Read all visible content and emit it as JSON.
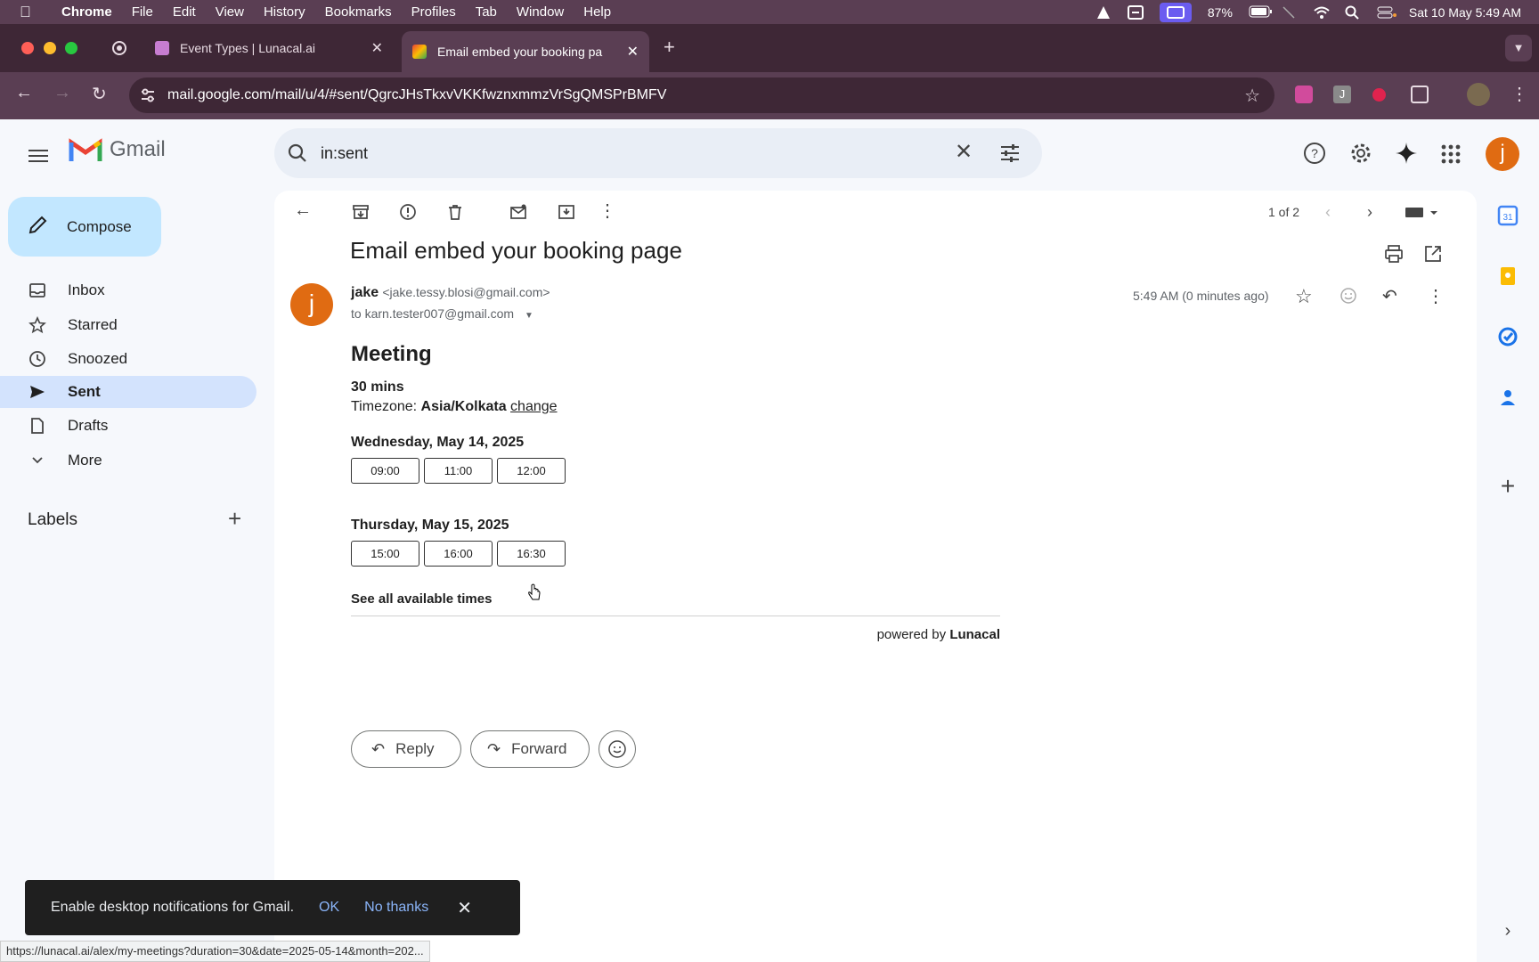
{
  "menubar": {
    "app": "Chrome",
    "items": [
      "File",
      "Edit",
      "View",
      "History",
      "Bookmarks",
      "Profiles",
      "Tab",
      "Window",
      "Help"
    ],
    "battery": "87%",
    "datetime": "Sat 10 May  5:49 AM"
  },
  "tabs": [
    {
      "title": "Event Types | Lunacal.ai"
    },
    {
      "title": "Email embed your booking pa"
    }
  ],
  "toolbar": {
    "url": "mail.google.com/mail/u/4/#sent/QgrcJHsTkxvVKKfwznxmmzVrSgQMSPrBMFV"
  },
  "gmail": {
    "logo_text": "Gmail",
    "search": {
      "value": "in:sent"
    },
    "avatar_letter": "j",
    "compose_label": "Compose",
    "nav": [
      {
        "label": "Inbox"
      },
      {
        "label": "Starred"
      },
      {
        "label": "Snoozed"
      },
      {
        "label": "Sent"
      },
      {
        "label": "Drafts"
      },
      {
        "label": "More"
      }
    ],
    "labels_title": "Labels",
    "pager": "1 of 2"
  },
  "email": {
    "subject": "Email embed your booking page",
    "sender_initial": "j",
    "sender_name": "jake",
    "sender_email": "<jake.tessy.blosi@gmail.com>",
    "to": "to karn.tester007@gmail.com",
    "time": "5:49 AM (0 minutes ago)",
    "body": {
      "title": "Meeting",
      "duration": "30 mins",
      "tz_prefix": "Timezone: ",
      "tz_value": "Asia/Kolkata",
      "tz_change": "change",
      "days": [
        {
          "label": "Wednesday, May 14, 2025",
          "slots": [
            "09:00",
            "11:00",
            "12:00"
          ]
        },
        {
          "label": "Thursday, May 15, 2025",
          "slots": [
            "15:00",
            "16:00",
            "16:30"
          ]
        }
      ],
      "see_all": "See all available times",
      "powered_prefix": "powered by ",
      "powered_brand": "Lunacal"
    },
    "reply_label": "Reply",
    "forward_label": "Forward"
  },
  "snackbar": {
    "message": "Enable desktop notifications for Gmail.",
    "ok": "OK",
    "no": "No thanks"
  },
  "status_url": "https://lunacal.ai/alex/my-meetings?duration=30&date=2025-05-14&month=202..."
}
